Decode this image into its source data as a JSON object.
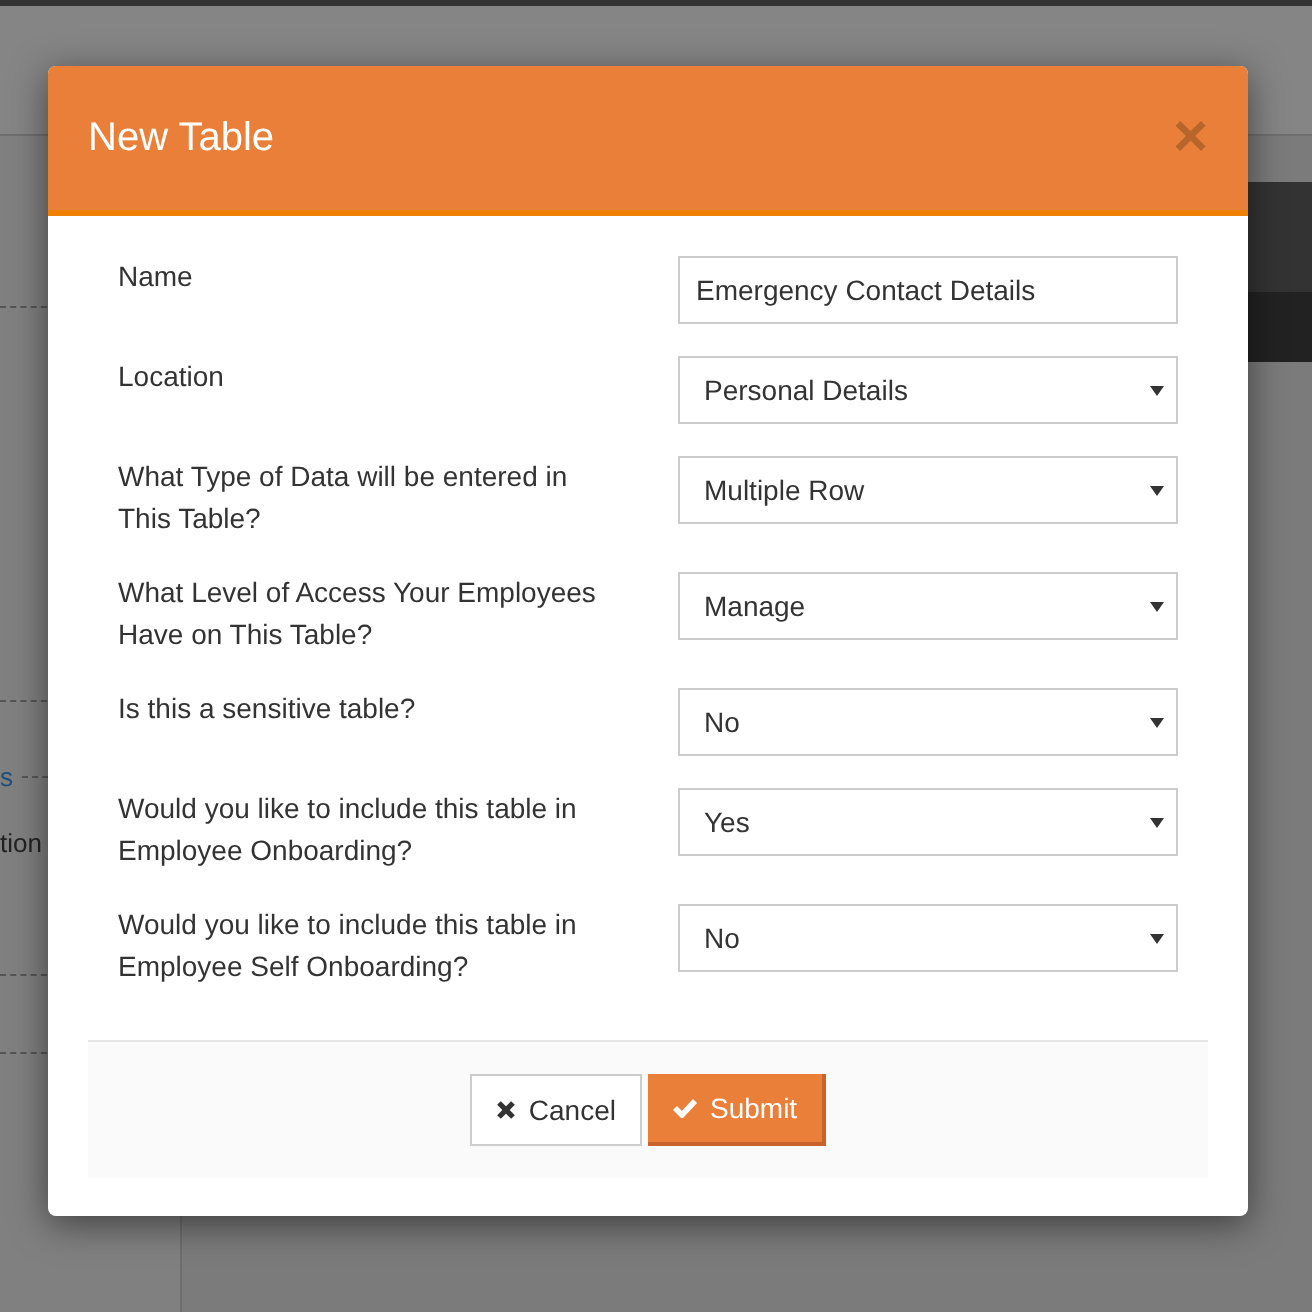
{
  "background": {
    "link_fragment": "s",
    "text_fragment": "tion"
  },
  "dialog": {
    "title": "New Table",
    "close": "×",
    "fields": [
      {
        "kind": "input",
        "label": "Name",
        "value": "Emergency Contact Details"
      },
      {
        "kind": "select",
        "label": "Location",
        "value": "Personal Details"
      },
      {
        "kind": "select",
        "label": "What Type of Data will be entered in This Table?",
        "value": "Multiple Row"
      },
      {
        "kind": "select",
        "label": "What Level of Access Your Employees Have on This Table?",
        "value": "Manage"
      },
      {
        "kind": "select",
        "label": "Is this a sensitive table?",
        "value": "No"
      },
      {
        "kind": "select",
        "label": "Would you like to include this table in Employee Onboarding?",
        "value": "Yes"
      },
      {
        "kind": "select",
        "label": "Would you like to include this table in Employee Self Onboarding?",
        "value": "No"
      }
    ],
    "buttons": [
      {
        "kind": "cancel",
        "label": "Cancel"
      },
      {
        "kind": "submit",
        "label": "Submit"
      }
    ]
  }
}
